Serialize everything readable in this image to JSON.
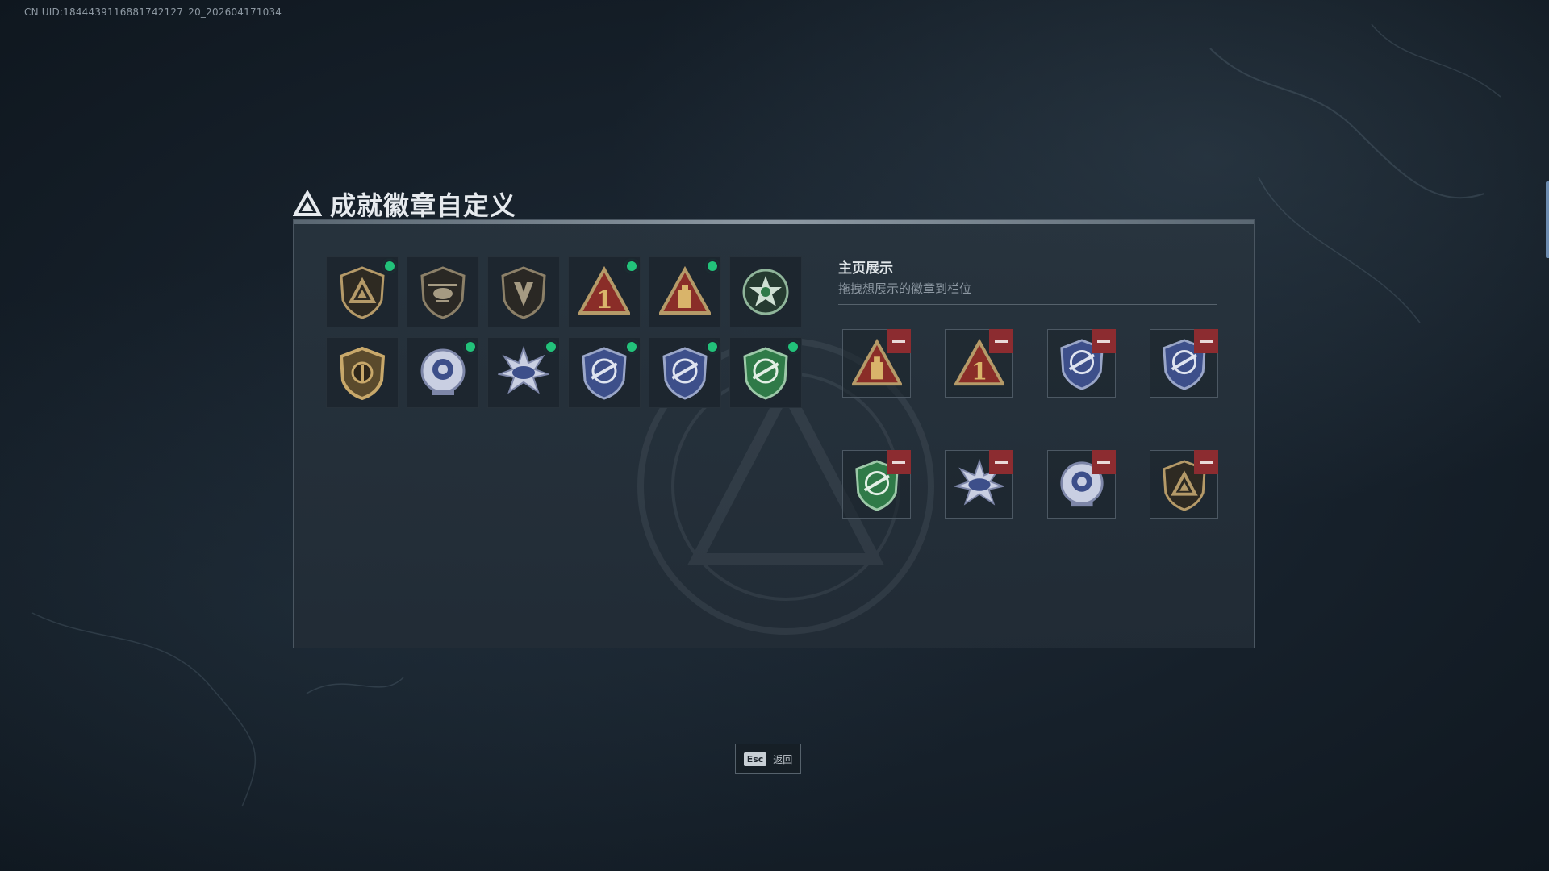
{
  "uid_text": "CN UID:1844439116881742127 20_202604171034",
  "title": "成就徽章自定义",
  "inventory": [
    {
      "icon": "triangle-shield-badge-icon",
      "new": true
    },
    {
      "icon": "helicopter-shield-badge-icon",
      "new": false
    },
    {
      "icon": "arrow-shield-badge-icon",
      "new": false
    },
    {
      "icon": "red-triangle-1-badge-icon",
      "new": true
    },
    {
      "icon": "red-triangle-tower-badge-icon",
      "new": true
    },
    {
      "icon": "green-star-wreath-badge-icon",
      "new": false
    },
    {
      "icon": "gold-oval-badge-icon",
      "new": false
    },
    {
      "icon": "blue-rose-badge-icon",
      "new": true
    },
    {
      "icon": "blue-star-badge-icon",
      "new": true
    },
    {
      "icon": "blue-rifle-shield-badge-icon",
      "new": true
    },
    {
      "icon": "blue-rifle-shield-badge-icon",
      "new": true
    },
    {
      "icon": "green-rifle-shield-badge-icon",
      "new": true
    }
  ],
  "showcase": {
    "title": "主页展示",
    "subtitle": "拖拽想展示的徽章到栏位",
    "slots": [
      {
        "icon": "red-triangle-tower-badge-icon"
      },
      {
        "icon": "red-triangle-1-badge-icon"
      },
      {
        "icon": "blue-rifle-shield-badge-icon"
      },
      {
        "icon": "blue-rifle-shield-badge-icon"
      },
      {
        "icon": "green-rifle-shield-badge-icon"
      },
      {
        "icon": "blue-star-badge-icon"
      },
      {
        "icon": "blue-rose-badge-icon"
      },
      {
        "icon": "triangle-shield-badge-icon"
      }
    ]
  },
  "footer": {
    "esc_key": "Esc",
    "esc_label": "返回"
  },
  "colors": {
    "new_dot": "#22c27a",
    "remove_button": "#8c2c30",
    "gold": "#b59a68",
    "red_badge": "#8a2d28",
    "blue_badge": "#3d4f8a",
    "green_badge": "#2f7a48"
  }
}
